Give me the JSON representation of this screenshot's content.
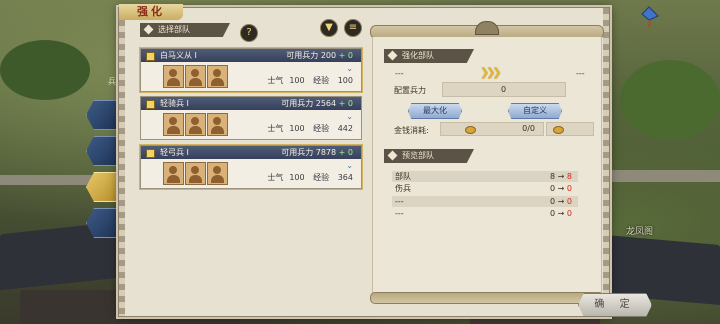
{
  "window": {
    "title": "强化"
  },
  "background": {
    "place_name": "龙凤阁",
    "left_label": "兵"
  },
  "left_panel": {
    "header": "选择部队",
    "help_glyph": "?",
    "filter_glyph": "▼",
    "sort_glyph": "≡"
  },
  "troops": [
    {
      "name": "白马义从 I",
      "power_label": "可用兵力",
      "power": "200",
      "plus": "+ 0",
      "morale_label": "士气",
      "morale": "100",
      "exp_label": "经验",
      "exp": "100",
      "selected": true
    },
    {
      "name": "轻骑兵 I",
      "power_label": "可用兵力",
      "power": "2564",
      "plus": "+ 0",
      "morale_label": "士气",
      "morale": "100",
      "exp_label": "经验",
      "exp": "442",
      "selected": false
    },
    {
      "name": "轻弓兵 I",
      "power_label": "可用兵力",
      "power": "7878",
      "plus": "+ 0",
      "morale_label": "士气",
      "morale": "100",
      "exp_label": "经验",
      "exp": "364",
      "selected": true
    }
  ],
  "reinforce": {
    "header": "强化部队",
    "left_dash": "---",
    "right_dash": "---",
    "alloc_label": "配置兵力",
    "alloc_value": "0",
    "max_button": "最大化",
    "custom_button": "自定义",
    "cost_label": "金钱消耗:",
    "cost_value": "0/0"
  },
  "preview": {
    "header": "预览部队",
    "rows": [
      {
        "label": "部队",
        "from": "8",
        "arrow": "→",
        "to": "8"
      },
      {
        "label": "伤兵",
        "from": "0",
        "arrow": "→",
        "to": "0"
      },
      {
        "label": "---",
        "from": "0",
        "arrow": "→",
        "to": "0"
      },
      {
        "label": "---",
        "from": "0",
        "arrow": "→",
        "to": "0"
      }
    ]
  },
  "confirm_button": "确 定",
  "colors": {
    "accent": "#f1d57a",
    "title_red": "#8a2c16",
    "highlight_red": "#d42a1b",
    "card_header": "#4f5b78"
  }
}
